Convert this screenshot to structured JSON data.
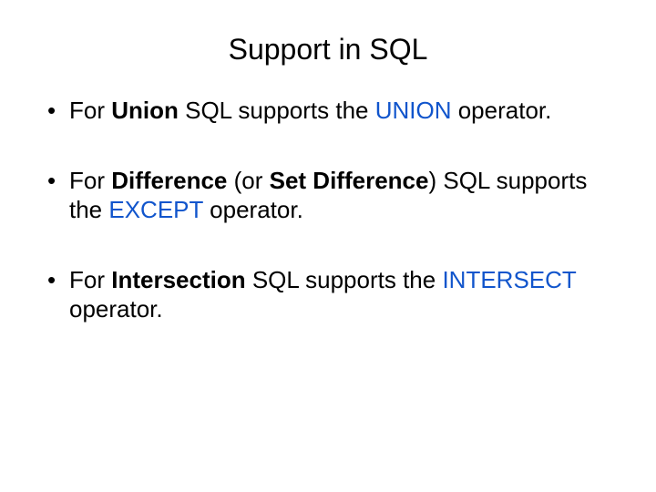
{
  "title": "Support in SQL",
  "bullets": [
    {
      "p1": "For ",
      "b1": "Union",
      "p2": " SQL supports the ",
      "kw": "UNION",
      "p3": " operator."
    },
    {
      "p1": "For ",
      "b1": "Difference",
      "p2": " (or ",
      "b2": "Set Difference",
      "p3": ") SQL supports the ",
      "kw": "EXCEPT",
      "p4": " operator."
    },
    {
      "p1": "For ",
      "b1": "Intersection",
      "p2": " SQL supports the ",
      "kw": "INTERSECT",
      "p3": " operator."
    }
  ]
}
